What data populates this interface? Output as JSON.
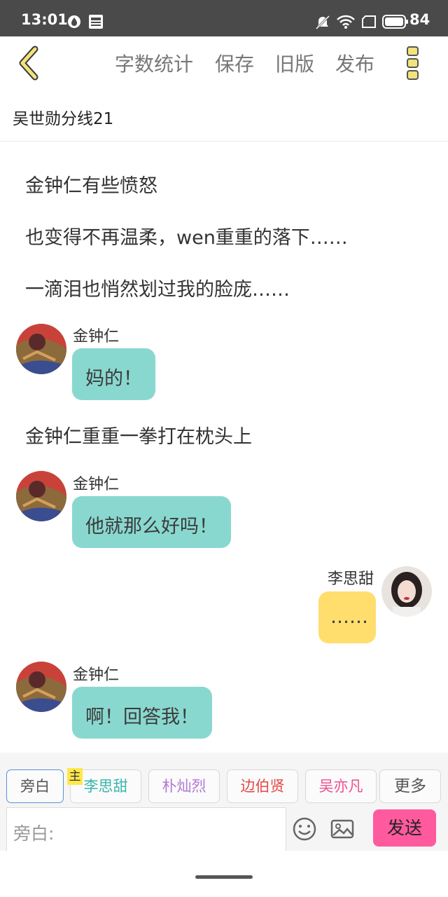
{
  "status_bar": {
    "time": "13:01",
    "battery": "84",
    "icons": [
      "data-saver-icon",
      "news-icon",
      "mute-icon",
      "wifi-icon",
      "sim-icon",
      "battery-icon"
    ]
  },
  "toolbar": {
    "back_icon": "chevron-left-icon",
    "items": [
      "字数统计",
      "保存",
      "旧版",
      "发布"
    ],
    "more_icon": "vertical-dots-icon",
    "accent_color": "#e8d96a"
  },
  "title": "吴世勋分线21",
  "messages": [
    {
      "type": "narration",
      "text": "金钟仁有些愤怒"
    },
    {
      "type": "narration",
      "text": "也变得不再温柔，wen重重的落下……"
    },
    {
      "type": "narration",
      "text": "一滴泪也悄然划过我的脸庞……"
    },
    {
      "type": "chat",
      "side": "left",
      "speaker": "金钟仁",
      "text": "妈的！"
    },
    {
      "type": "narration",
      "text": "金钟仁重重一拳打在枕头上"
    },
    {
      "type": "chat",
      "side": "left",
      "speaker": "金钟仁",
      "text": "他就那么好吗！"
    },
    {
      "type": "chat",
      "side": "right",
      "speaker": "李思甜",
      "text": "……"
    },
    {
      "type": "chat",
      "side": "left",
      "speaker": "金钟仁",
      "text": "啊！回答我！"
    }
  ],
  "bubble_colors": {
    "left": "#89d8cf",
    "right": "#ffde6e"
  },
  "roles": [
    {
      "label": "旁白",
      "color": "#555555",
      "active": true
    },
    {
      "label": "李思甜",
      "color": "#3ab5ac",
      "badge": "主"
    },
    {
      "label": "朴灿烈",
      "color": "#b277d6"
    },
    {
      "label": "边伯贤",
      "color": "#e54848"
    },
    {
      "label": "吴亦凡",
      "color": "#ee4f8f"
    },
    {
      "label": "更多",
      "color": "#555555"
    }
  ],
  "input": {
    "placeholder": "旁白:"
  },
  "send_label": "发送",
  "send_color": "#ff5a9e"
}
